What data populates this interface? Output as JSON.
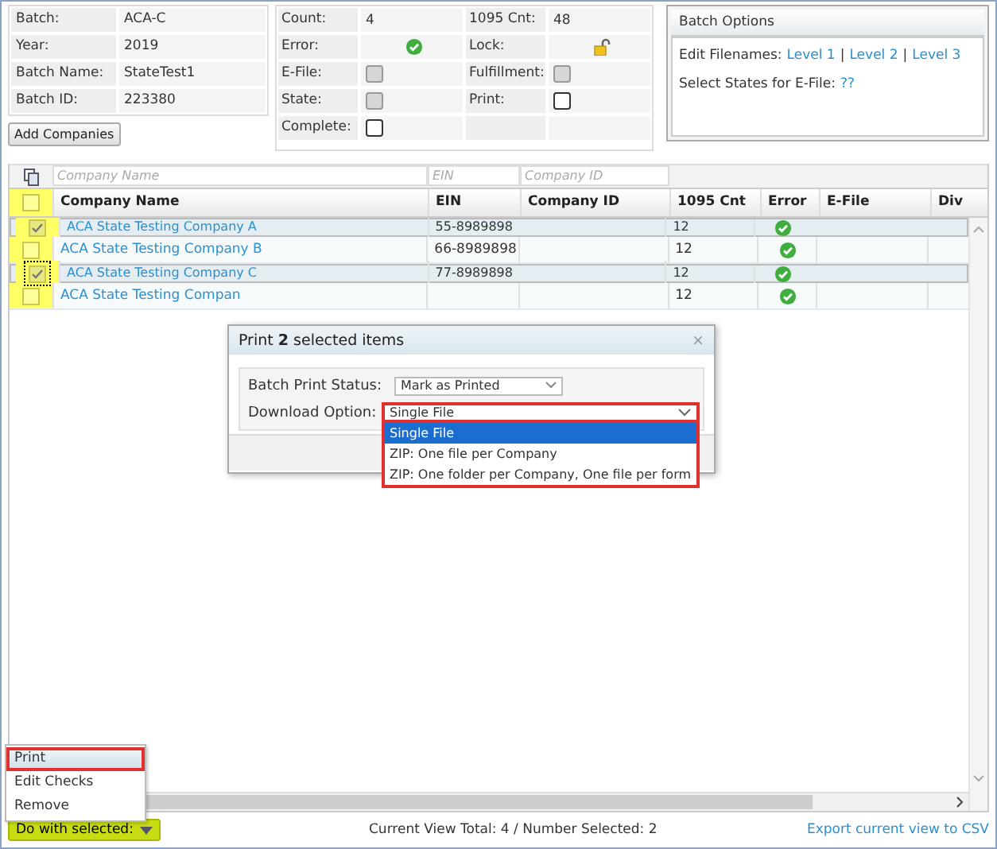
{
  "batch_info": [
    {
      "label": "Batch:",
      "value": "ACA-C"
    },
    {
      "label": "Year:",
      "value": "2019"
    },
    {
      "label": "Batch Name:",
      "value": "StateTest1"
    },
    {
      "label": "Batch ID:",
      "value": "223380"
    }
  ],
  "add_button": "Add Companies",
  "status": [
    {
      "label": "Count:",
      "kind": "text",
      "value": "4"
    },
    {
      "label": "1095 Cnt:",
      "kind": "text",
      "value": "48"
    },
    {
      "label": "Error:",
      "kind": "ok"
    },
    {
      "label": "Lock:",
      "kind": "lock"
    },
    {
      "label": "E-File:",
      "kind": "checkbox",
      "checked": false,
      "disabled": true
    },
    {
      "label": "Fulfillment:",
      "kind": "checkbox",
      "checked": false,
      "disabled": true
    },
    {
      "label": "State:",
      "kind": "checkbox",
      "checked": false,
      "disabled": true
    },
    {
      "label": "Print:",
      "kind": "checkbox",
      "checked": false,
      "disabled": false
    },
    {
      "label": "Complete:",
      "kind": "checkbox",
      "checked": false,
      "disabled": false
    }
  ],
  "batch_options": {
    "title": "Batch Options",
    "filenames_label": "Edit Filenames:",
    "levels": [
      "Level 1",
      "Level 2",
      "Level 3"
    ],
    "separator": "|",
    "states_label": "Select States for E-File:",
    "states_link": "??"
  },
  "grid": {
    "filters": [
      {
        "placeholder": "Company Name"
      },
      {
        "placeholder": "EIN"
      },
      {
        "placeholder": "Company ID"
      }
    ],
    "header_checked": false,
    "columns": [
      "Company Name",
      "EIN",
      "Company ID",
      "1095 Cnt",
      "Error",
      "E-File",
      "Div"
    ],
    "rows": [
      {
        "selected": true,
        "focused": false,
        "name": "ACA State Testing Company A",
        "ein": "55-8989898",
        "count": "12",
        "error": false
      },
      {
        "selected": false,
        "focused": false,
        "name": "ACA State Testing Company B",
        "ein": "66-8989898",
        "count": "12",
        "error": false
      },
      {
        "selected": true,
        "focused": true,
        "name": "ACA State Testing Company C",
        "ein": "77-8989898",
        "count": "12",
        "error": false
      },
      {
        "selected": false,
        "focused": false,
        "name": "ACA State Testing Compan",
        "count": "12",
        "error": false
      }
    ]
  },
  "menu": [
    {
      "label": "Print",
      "selected": true
    },
    {
      "label": "Edit Checks",
      "selected": false
    },
    {
      "label": "Remove",
      "selected": false
    }
  ],
  "footer": {
    "action_button": "Do with selected:",
    "summary": "Current View Total: 4 / Number Selected: 2",
    "export_link": "Export current view to CSV"
  },
  "dialog": {
    "title": "Print **2** selected items",
    "close": "×",
    "print_status_label": "Batch Print Status:",
    "print_status_value": "Mark as Printed",
    "download_label": "Download Option:",
    "download_value": "Single File",
    "download_options": [
      {
        "label": "Single File",
        "selected": true
      },
      {
        "label": "ZIP: One file per Company",
        "selected": false
      },
      {
        "label": "ZIP: One folder per Company, One file per form",
        "selected": false
      }
    ]
  }
}
